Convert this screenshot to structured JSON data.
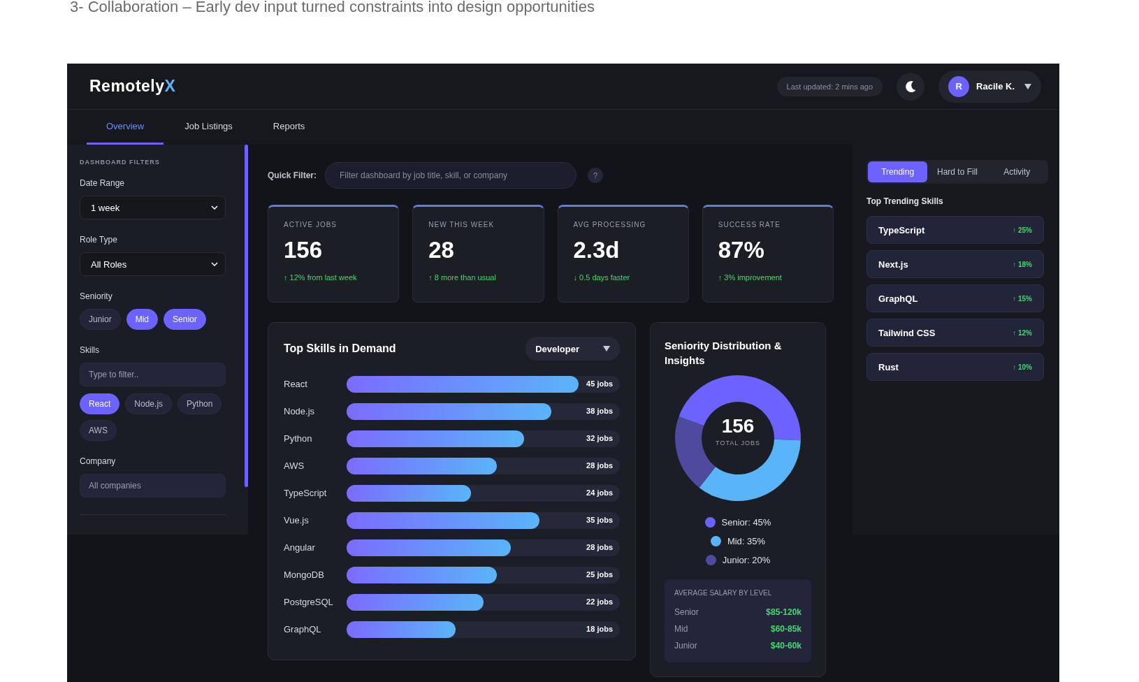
{
  "caption": "3- Collaboration – Early dev input turned constraints into design opportunities",
  "header": {
    "logo": "Remotely",
    "logo_accent": "X",
    "last_updated": "Last updated: 2 mins ago",
    "user": {
      "initial": "R",
      "name": "Racile K."
    }
  },
  "tabs": [
    {
      "label": "Overview",
      "selected": true
    },
    {
      "label": "Job Listings",
      "selected": false
    },
    {
      "label": "Reports",
      "selected": false
    }
  ],
  "filters": {
    "heading": "DASHBOARD FILTERS",
    "date_range": {
      "label": "Date Range",
      "value": "1 week"
    },
    "role_type": {
      "label": "Role Type",
      "value": "All Roles"
    },
    "seniority": {
      "label": "Seniority",
      "chips": [
        {
          "label": "Junior",
          "selected": false
        },
        {
          "label": "Mid",
          "selected": true
        },
        {
          "label": "Senior",
          "selected": true
        }
      ]
    },
    "skills": {
      "label": "Skills",
      "placeholder": "Type to filter..",
      "chips": [
        {
          "label": "React",
          "selected": true
        },
        {
          "label": "Node.js",
          "selected": false
        },
        {
          "label": "Python",
          "selected": false
        },
        {
          "label": "AWS",
          "selected": false
        }
      ]
    },
    "company": {
      "label": "Company",
      "placeholder": "All companies"
    }
  },
  "quick_filter": {
    "label": "Quick Filter:",
    "placeholder": "Filter dashboard by job title, skill, or company",
    "help": "?"
  },
  "stats": [
    {
      "label": "ACTIVE JOBS",
      "value": "156",
      "change": "↑ 12% from last week"
    },
    {
      "label": "NEW THIS WEEK",
      "value": "28",
      "change": "↑ 8 more than usual"
    },
    {
      "label": "AVG PROCESSING",
      "value": "2.3d",
      "change": "↓ 0.5 days faster"
    },
    {
      "label": "SUCCESS RATE",
      "value": "87%",
      "change": "↑ 3% improvement"
    }
  ],
  "skills_card": {
    "title": "Top Skills in Demand",
    "dropdown": "Developer",
    "rows": [
      {
        "name": "React",
        "level": 0.85,
        "count": "45 jobs"
      },
      {
        "name": "Node.js",
        "level": 0.75,
        "count": "38 jobs"
      },
      {
        "name": "Python",
        "level": 0.65,
        "count": "32 jobs"
      },
      {
        "name": "AWS",
        "level": 0.55,
        "count": "28 jobs"
      },
      {
        "name": "TypeScript",
        "level": 0.455,
        "count": "24 jobs"
      },
      {
        "name": "Vue.js",
        "level": 0.705,
        "count": "35 jobs"
      },
      {
        "name": "Angular",
        "level": 0.6,
        "count": "28 jobs"
      },
      {
        "name": "MongoDB",
        "level": 0.55,
        "count": "25 jobs"
      },
      {
        "name": "PostgreSQL",
        "level": 0.5,
        "count": "22 jobs"
      },
      {
        "name": "GraphQL",
        "level": 0.4,
        "count": "18 jobs"
      }
    ]
  },
  "seniority_card": {
    "title": "Seniority Distribution & Insights",
    "total": "156",
    "total_label": "TOTAL JOBS",
    "chart_data": {
      "type": "donut",
      "values": [
        45,
        35,
        20
      ]
    },
    "legend": [
      {
        "label": "Senior: 45%",
        "color": "#6c63ff"
      },
      {
        "label": "Mid: 35%",
        "color": "#5ab4f8"
      },
      {
        "label": "Junior: 20%",
        "color": "#4e4a9e"
      }
    ],
    "salary": {
      "title": "AVERAGE SALARY BY LEVEL",
      "rows": [
        {
          "level": "Senior",
          "range": "$85-120k"
        },
        {
          "level": "Mid",
          "range": "$60-85k"
        },
        {
          "level": "Junior",
          "range": "$40-60k"
        }
      ]
    }
  },
  "side_panel": {
    "tabs": [
      {
        "label": "Trending",
        "selected": true
      },
      {
        "label": "Hard to Fill",
        "selected": false
      },
      {
        "label": "Activity",
        "selected": false
      }
    ],
    "title": "Top Trending Skills",
    "items": [
      {
        "name": "TypeScript",
        "change": "↑ 25%"
      },
      {
        "name": "Next.js",
        "change": "↑ 18%"
      },
      {
        "name": "GraphQL",
        "change": "↑ 15%"
      },
      {
        "name": "Tailwind CSS",
        "change": "↑ 12%"
      },
      {
        "name": "Rust",
        "change": "↑ 10%"
      }
    ]
  }
}
